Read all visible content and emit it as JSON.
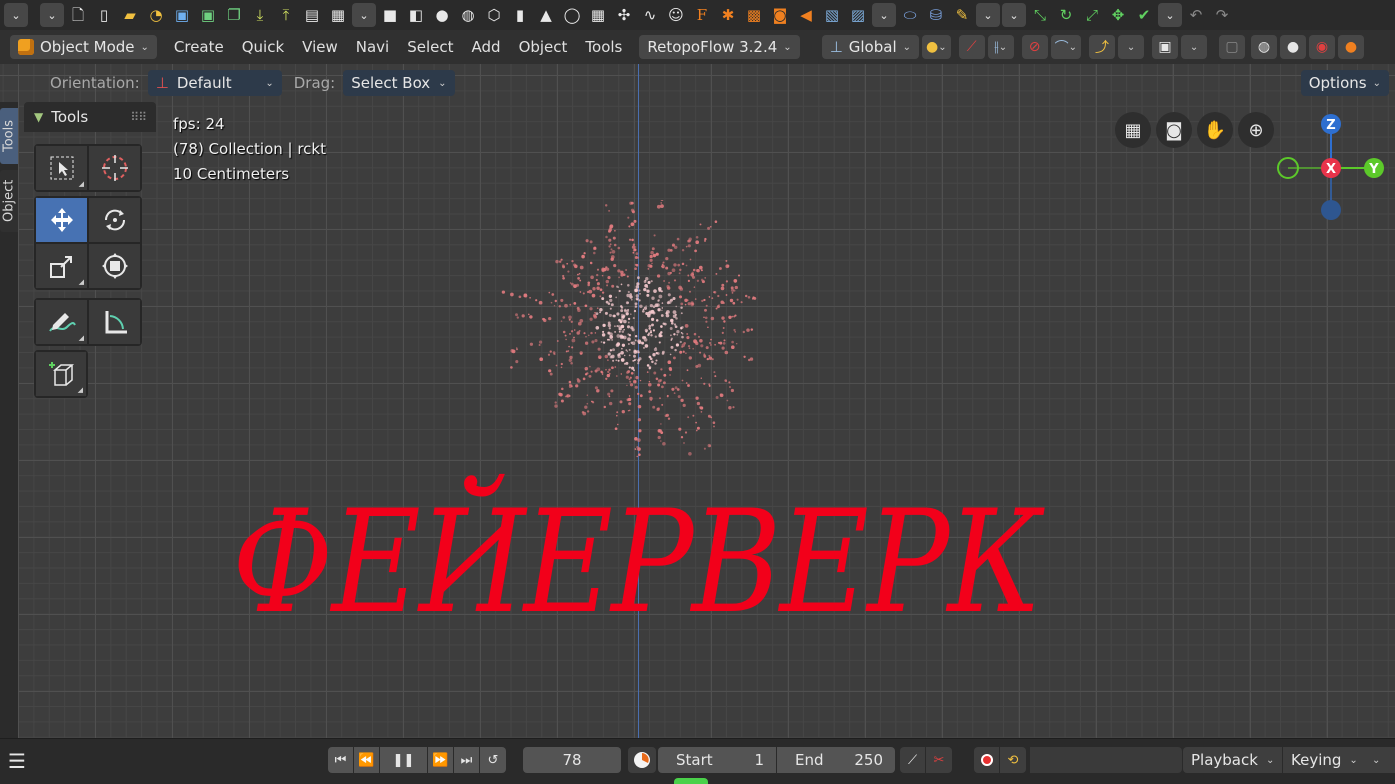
{
  "topbar": {
    "icons": [
      "dropdown-chevron-icon",
      "dropdown-chevron-icon",
      "new-file-icon",
      "new-document-icon",
      "open-folder-icon",
      "recent-folder-icon",
      "save-icon",
      "save-as-icon",
      "save-copy-icon",
      "import-icon",
      "export-icon",
      "render-image-icon",
      "render-animation-icon",
      "dropdown-chevron-icon",
      "plane-icon",
      "cube-icon",
      "sphere-icon",
      "uv-sphere-icon",
      "ico-sphere-icon",
      "cylinder-icon",
      "cone-icon",
      "torus-icon",
      "grid-icon",
      "empty-axes-icon",
      "curve-icon",
      "monkey-icon",
      "text-f-icon",
      "armature-icon",
      "lattice-icon",
      "camera-icon",
      "speaker-icon",
      "image-icon",
      "image-empty-icon",
      "dropdown-chevron-icon",
      "ellipse-icon",
      "cylinder-blue-icon",
      "brush-icon",
      "dropdown-chevron-icon",
      "dropdown-chevron-icon",
      "snap-icon",
      "rotate-icon",
      "scale-icon",
      "transform-icon",
      "apply-icon",
      "dropdown-chevron-icon",
      "undo-icon",
      "redo-icon"
    ]
  },
  "header": {
    "mode": "Object Mode",
    "menus": [
      "Create",
      "Quick",
      "View",
      "Navi",
      "Select",
      "Add",
      "Object",
      "Tools"
    ],
    "addon": "RetopoFlow 3.2.4",
    "orientation": "Global"
  },
  "toolsettings": {
    "orientation_label": "Orientation:",
    "orientation_value": "Default",
    "drag_label": "Drag:",
    "drag_value": "Select Box",
    "options": "Options"
  },
  "sidebar": {
    "tabs": [
      "Tools",
      "Object"
    ],
    "panel_title": "Tools"
  },
  "overlay": {
    "fps": "fps: 24",
    "collection": "(78) Collection | rckt",
    "scale": "10 Centimeters"
  },
  "gizmo": {
    "z": "Z",
    "x": "X",
    "y": "Y",
    "colors": {
      "x": "#e8334a",
      "y": "#5cc92a",
      "z": "#2e6fd0"
    }
  },
  "scene": {
    "title": "ФЕЙЕРВЕРК",
    "title_color": "#f2001a",
    "particle_color": "#e07a7e"
  },
  "timeline": {
    "current_frame": "78",
    "start_label": "Start",
    "start_value": "1",
    "end_label": "End",
    "end_value": "250",
    "playback": "Playback",
    "keying": "Keying"
  }
}
